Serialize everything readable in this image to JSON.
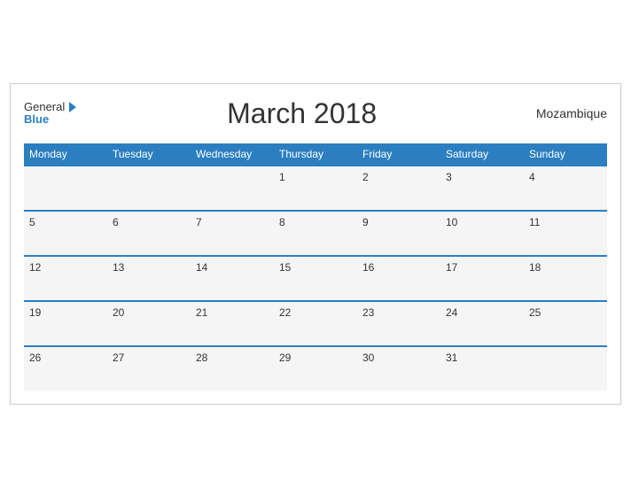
{
  "header": {
    "logo_general": "General",
    "logo_blue": "Blue",
    "title": "March 2018",
    "country": "Mozambique"
  },
  "days_of_week": [
    "Monday",
    "Tuesday",
    "Wednesday",
    "Thursday",
    "Friday",
    "Saturday",
    "Sunday"
  ],
  "weeks": [
    [
      "",
      "",
      "",
      "1",
      "2",
      "3",
      "4"
    ],
    [
      "5",
      "6",
      "7",
      "8",
      "9",
      "10",
      "11"
    ],
    [
      "12",
      "13",
      "14",
      "15",
      "16",
      "17",
      "18"
    ],
    [
      "19",
      "20",
      "21",
      "22",
      "23",
      "24",
      "25"
    ],
    [
      "26",
      "27",
      "28",
      "29",
      "30",
      "31",
      ""
    ]
  ]
}
